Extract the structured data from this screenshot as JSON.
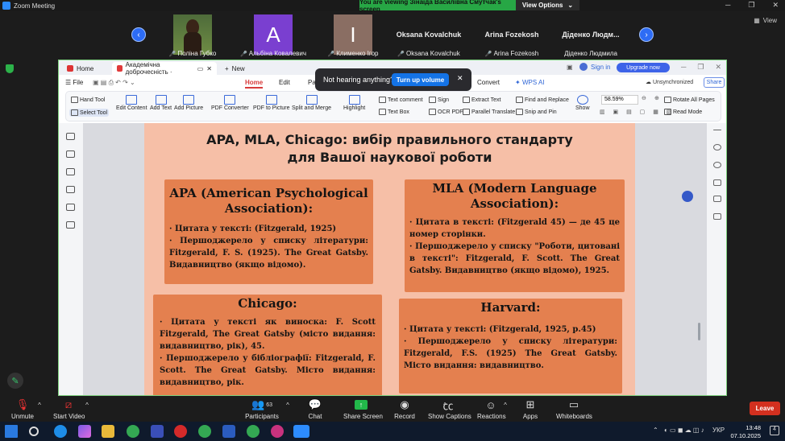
{
  "zoom": {
    "title": "Zoom Meeting",
    "viewing_banner": "You are viewing Зінаїда Василівна Смутчак's screen",
    "view_options": "View Options",
    "view_label": "View",
    "participants": [
      {
        "name": "Поліна Губко",
        "muted": true,
        "type": "photo"
      },
      {
        "name": "Альбіна Ковалевич",
        "muted": true,
        "type": "letter",
        "letter": "A",
        "color": "#7a3fd0"
      },
      {
        "name": "Клименко Ігор",
        "muted": true,
        "type": "letter",
        "letter": "І",
        "color": "#8a6e63"
      },
      {
        "name": "Oksana Kovalchuk",
        "label": "Oksana Kovalchuk",
        "muted": true,
        "type": "name"
      },
      {
        "name": "Arina Fozekosh",
        "label": "Arina Fozekosh",
        "muted": true,
        "type": "name"
      },
      {
        "name": "Діденко Людмила",
        "label": "Діденко Людм...",
        "muted": false,
        "type": "name"
      }
    ],
    "toolbar": {
      "unmute": "Unmute",
      "start_video": "Start Video",
      "participants": "Participants",
      "participants_count": "63",
      "chat": "Chat",
      "share_screen": "Share Screen",
      "record": "Record",
      "show_captions": "Show Captions",
      "reactions": "Reactions",
      "apps": "Apps",
      "whiteboards": "Whiteboards",
      "leave": "Leave"
    }
  },
  "wps": {
    "tabs": {
      "home": "Home",
      "doc": "Академічна доброчесність ·",
      "new": "New"
    },
    "sign_in": "Sign in",
    "upgrade": "Upgrade now",
    "menu": {
      "file": "File",
      "home": "Home",
      "edit": "Edit",
      "page": "Pa",
      "convert": "Convert",
      "wps_ai": "WPS AI",
      "unsynced": "Unsynchronized",
      "share": "Share"
    },
    "toolbar": {
      "hand_tool": "Hand Tool",
      "select_tool": "Select Tool",
      "edit_content": "Edit Content",
      "add_text": "Add Text",
      "add_picture": "Add Picture",
      "pdf_converter": "PDF Converter",
      "pdf_to_picture": "PDF to Picture",
      "split_merge": "Split and Merge",
      "highlight": "Highlight",
      "text_comment": "Text comment",
      "text_box": "Text Box",
      "sign": "Sign",
      "ocr_pdf": "OCR PDF",
      "extract_text": "Extract Text",
      "parallel_translate": "Parallel Translate",
      "find_replace": "Find and Replace",
      "snip_pin": "Snip and Pin",
      "show": "Show",
      "zoom": "58.59%",
      "rotate_all": "Rotate All Pages",
      "read_mode": "Read Mode"
    },
    "popup": {
      "text": "Not hearing anything?",
      "button": "Turn up volume"
    }
  },
  "slide": {
    "title_line1": "APA, MLA, Chicago: вибір правильного стандарту",
    "title_line2": "для Вашої наукової роботи",
    "apa_title": "APA (American Psychological Association):",
    "apa_body1": "· Цитата у тексті: (Fitzgerald, 1925)",
    "apa_body2": "· Першоджерело у списку літератури: Fitzgerald, F. S. (1925). The Great Gatsby. Видавництво (якщо відомо).",
    "mla_title": "MLA (Modern Language Association):",
    "mla_body1": "· Цитата в тексті: (Fitzgerald 45) — де 45 це номер сторінки.",
    "mla_body2": "· Першоджерело у списку \"Роботи, цитовані в тексті\": Fitzgerald, F. Scott. The Great Gatsby. Видавництво (якщо відомо), 1925.",
    "chicago_title": "Chicago:",
    "chicago_body1": "· Цитата у тексті як виноска: F. Scott Fitzgerald, The Great Gatsby (місто видання: видавництво, рік), 45.",
    "chicago_body2": "· Першоджерело у бібліографії: Fitzgerald, F. Scott. The Great Gatsby. Місто видання: видавництво, рік.",
    "harvard_title": "Harvard:",
    "harvard_body1": "· Цитата у тексті: (Fitzgerald, 1925, p.45)",
    "harvard_body2": "· Першоджерело у списку літератури: Fitzgerald, F.S. (1925) The Great Gatsby. Місто видання: видавництво."
  },
  "taskbar": {
    "lang": "УКР",
    "time": "13:48",
    "date": "07.10.2025"
  }
}
